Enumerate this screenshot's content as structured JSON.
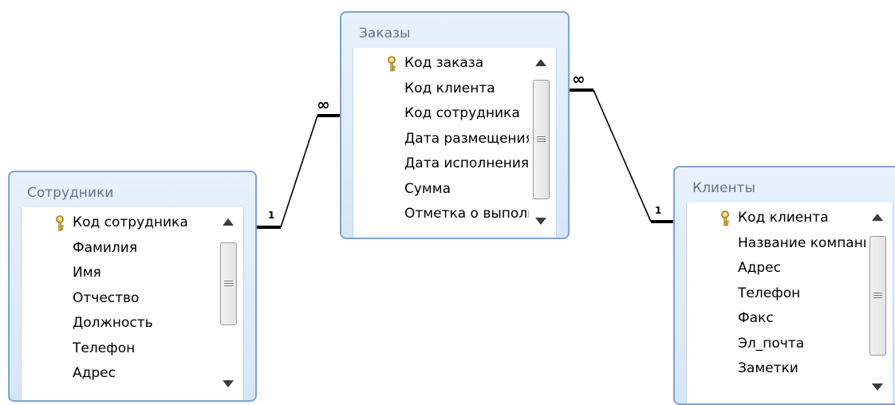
{
  "tables": [
    {
      "id": "employees",
      "title": "Сотрудники",
      "fields": [
        {
          "name": "Код сотрудника",
          "key": true
        },
        {
          "name": "Фамилия",
          "key": false
        },
        {
          "name": "Имя",
          "key": false
        },
        {
          "name": "Отчество",
          "key": false
        },
        {
          "name": "Должность",
          "key": false
        },
        {
          "name": "Телефон",
          "key": false
        },
        {
          "name": "Адрес",
          "key": false
        }
      ]
    },
    {
      "id": "orders",
      "title": "Заказы",
      "fields": [
        {
          "name": "Код заказа",
          "key": true
        },
        {
          "name": "Код клиента",
          "key": false
        },
        {
          "name": "Код сотрудника",
          "key": false
        },
        {
          "name": "Дата размещения",
          "key": false
        },
        {
          "name": "Дата исполнения",
          "key": false
        },
        {
          "name": "Сумма",
          "key": false
        },
        {
          "name": "Отметка о выполнении",
          "key": false
        }
      ]
    },
    {
      "id": "clients",
      "title": "Клиенты",
      "fields": [
        {
          "name": "Код клиента",
          "key": true
        },
        {
          "name": "Название компании",
          "key": false
        },
        {
          "name": "Адрес",
          "key": false
        },
        {
          "name": "Телефон",
          "key": false
        },
        {
          "name": "Факс",
          "key": false
        },
        {
          "name": "Эл_почта",
          "key": false
        },
        {
          "name": "Заметки",
          "key": false
        }
      ]
    }
  ],
  "relationships": [
    {
      "from": "employees",
      "to": "orders",
      "from_cardinality": "1",
      "to_cardinality": "∞"
    },
    {
      "from": "orders",
      "to": "clients",
      "from_cardinality": "∞",
      "to_cardinality": "1"
    }
  ],
  "colors": {
    "border": "#7ea3d3",
    "header_top": "#e8f1fc",
    "header_bottom": "#d6e6fa",
    "title_text": "#5f7591",
    "key_icon": "#e2b33a"
  }
}
